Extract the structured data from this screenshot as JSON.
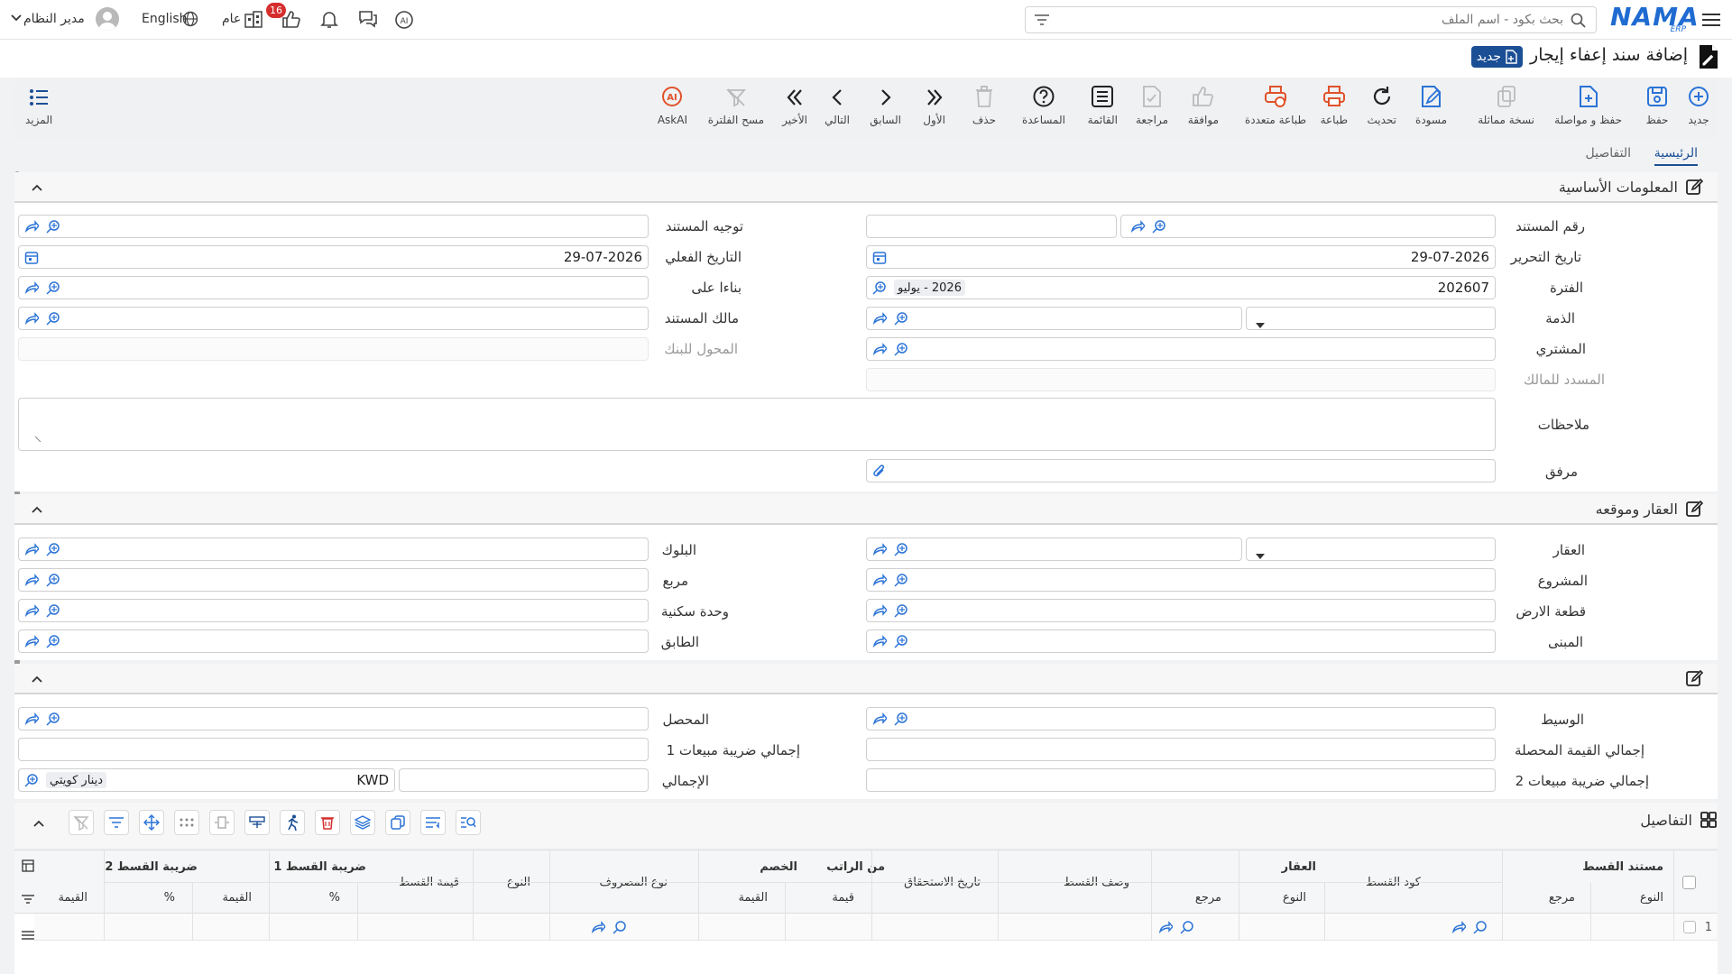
{
  "topbar": {
    "search_placeholder": "بحث بكود - اسم الملف",
    "logo": "NAMA",
    "logo_sub": "ERP",
    "user_name": "مدير النظام",
    "language": "English",
    "scope": "عام",
    "notification_count": "16"
  },
  "page": {
    "title": "إضافة سند إعفاء إيجار",
    "new_badge": "جديد"
  },
  "toolbar": {
    "new": "جديد",
    "save": "حفظ",
    "save_continue": "حفظ و مواصلة",
    "copy": "نسخة مماثلة",
    "draft": "مسودة",
    "refresh": "تحديث",
    "print": "طباعة",
    "multi_print": "طباعة متعددة",
    "approve": "موافقة",
    "review": "مراجعة",
    "list": "القائمة",
    "help": "المساعدة",
    "delete": "حذف",
    "first": "الأول",
    "previous": "السابق",
    "next": "التالي",
    "last": "الأخير",
    "clear_filter": "مسح الفلترة",
    "askai": "AskAI",
    "more": "المزيد"
  },
  "tabs": {
    "main": "الرئيسية",
    "details": "التفاصيل"
  },
  "basic_info": {
    "title": "المعلومات الأساسية",
    "doc_number_label": "رقم المستند",
    "doc_direction_label": "توجيه المستند",
    "edit_date_label": "تاريخ التحرير",
    "edit_date": "29-07-2026",
    "actual_date_label": "التاريخ الفعلي",
    "actual_date": "29-07-2026",
    "period_label": "الفترة",
    "period": "202607",
    "period_chip": "2026 - يوليو",
    "based_on_label": "بناءا على",
    "account_label": "الذمة",
    "doc_owner_label": "مالك المستند",
    "buyer_label": "المشتري",
    "bank_transfer_label": "المحول للبنك",
    "paid_to_owner_label": "المسدد للمالك",
    "notes_label": "ملاحظات",
    "attachment_label": "مرفق"
  },
  "property": {
    "title": "العقار وموقعه",
    "property_label": "العقار",
    "block_label": "البلوك",
    "project_label": "المشروع",
    "square_label": "مربع",
    "land_label": "قطعة الارض",
    "unit_label": "وحدة سكنية",
    "building_label": "المبنى",
    "floor_label": "الطابق"
  },
  "totals": {
    "broker_label": "الوسيط",
    "collector_label": "المحصل",
    "total_collected_label": "إجمالي القيمة المحصلة",
    "total_tax1_label": "إجمالي ضريبة مبيعات 1",
    "total_tax2_label": "إجمالي ضريبة مبيعات 2",
    "total_label": "الإجمالي",
    "currency_code": "KWD",
    "currency_name": "دينار كويتي"
  },
  "details": {
    "title": "التفاصيل",
    "groups": {
      "installment_doc": "مستند القسط",
      "property": "العقار",
      "from_salary": "من الراتب",
      "discount": "الخصم",
      "tax1": "ضريبة القسط 1",
      "tax2": "ضريبة القسط 2"
    },
    "columns": {
      "type": "النوع",
      "reference": "مرجع",
      "installment_code": "كود القسط",
      "prop_type": "النوع",
      "prop_reference": "مرجع",
      "installment_desc": "وصف القسط",
      "due_date": "تاريخ الاستحقاق",
      "salary_value": "قيمة",
      "discount_value": "القيمة",
      "expense_type": "نوع المصروف",
      "item_type": "النوع",
      "installment_value": "قيمة القسط",
      "tax1_pct": "%",
      "tax1_value": "القيمة",
      "tax2_pct": "%",
      "tax2_value": "القيمة"
    },
    "row_number": "1"
  }
}
